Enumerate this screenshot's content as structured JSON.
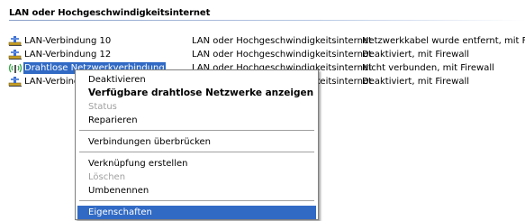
{
  "group": {
    "title": "LAN oder Hochgeschwindigkeitsinternet"
  },
  "connections": [
    {
      "name": "LAN-Verbindung 10",
      "type": "LAN oder Hochgeschwindigkeitsinternet",
      "status": "Netzwerkkabel wurde entfernt, mit Firew",
      "icon": "network-connection-icon"
    },
    {
      "name": "LAN-Verbindung 12",
      "type": "LAN oder Hochgeschwindigkeitsinternet",
      "status": "Deaktiviert, mit Firewall",
      "icon": "network-connection-icon"
    },
    {
      "name": "Drahtlose Netzwerkverbindung",
      "type": "LAN oder Hochgeschwindigkeitsinternet",
      "status": "Nicht verbunden, mit Firewall",
      "icon": "wireless-connection-icon"
    },
    {
      "name": "LAN-Verbindung",
      "type": "LAN oder Hochgeschwindigkeitsinternet",
      "status": "Deaktiviert, mit Firewall",
      "icon": "network-connection-icon"
    }
  ],
  "context_menu": {
    "items": [
      {
        "label": "Deaktivieren"
      },
      {
        "label": "Verfügbare drahtlose Netzwerke anzeigen"
      },
      {
        "label": "Status"
      },
      {
        "label": "Reparieren"
      },
      {
        "label": "Verbindungen überbrücken"
      },
      {
        "label": "Verknüpfung erstellen"
      },
      {
        "label": "Löschen"
      },
      {
        "label": "Umbenennen"
      },
      {
        "label": "Eigenschaften"
      }
    ]
  },
  "colors": {
    "selection": "#316ac5",
    "disabled_text": "#a0a0a0",
    "menu_border": "#808080"
  }
}
